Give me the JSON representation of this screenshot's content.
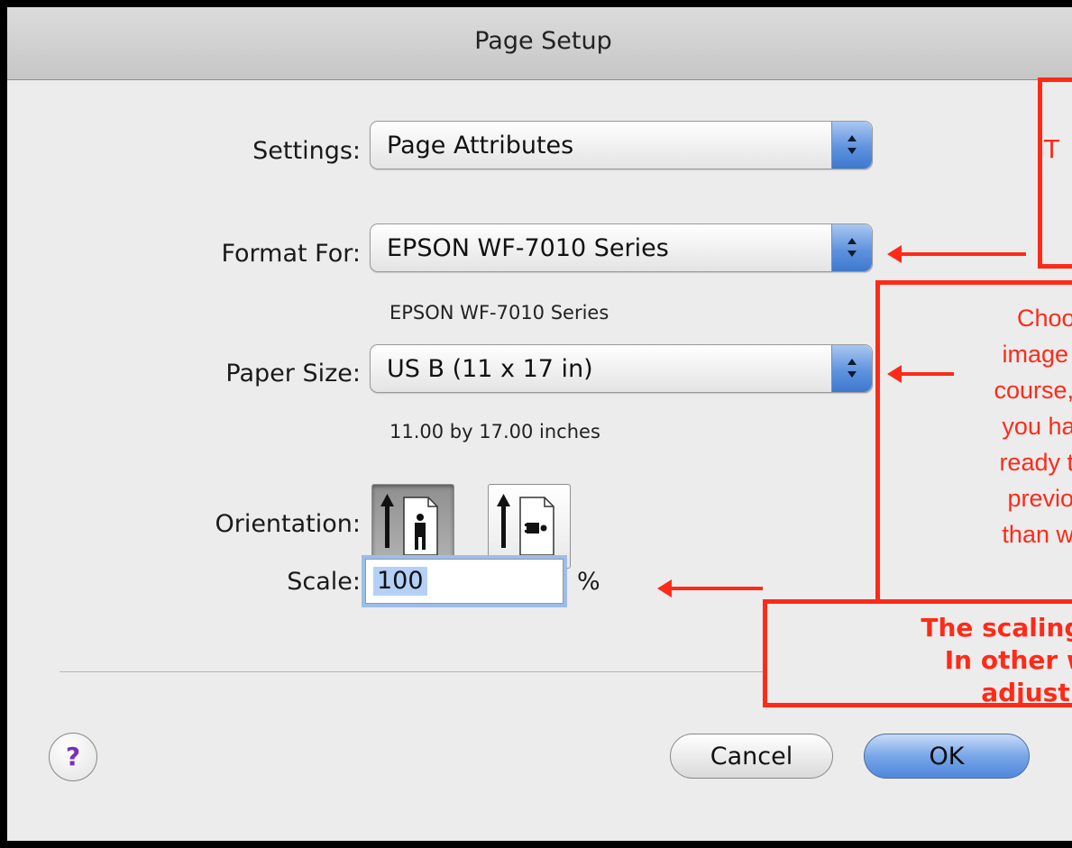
{
  "window": {
    "title": "Page Setup"
  },
  "settings": {
    "label": "Settings:",
    "value": "Page Attributes"
  },
  "format_for": {
    "label": "Format For:",
    "value": "EPSON WF-7010 Series",
    "sub": "EPSON WF-7010 Series"
  },
  "paper_size": {
    "label": "Paper Size:",
    "value": "US B (11 x 17 in)",
    "sub": "11.00 by 17.00 inches"
  },
  "orientation": {
    "label": "Orientation:",
    "selected": "portrait",
    "options": [
      "portrait",
      "landscape"
    ]
  },
  "scale": {
    "label": "Scale:",
    "value": "100",
    "unit": "%"
  },
  "buttons": {
    "help": "?",
    "cancel": "Cancel",
    "ok": "OK"
  },
  "callouts": {
    "top": {
      "line1": "T"
    },
    "middle": {
      "lines": [
        "Choos",
        "image y",
        "course, t",
        "you hav",
        "ready te",
        "previou",
        "than wh"
      ]
    },
    "bottom": {
      "lines": [
        "The scaling should",
        "In other words, ",
        "adjust the"
      ]
    }
  },
  "colors": {
    "annotation": "#ff2a18",
    "accent": "#4f87de"
  }
}
